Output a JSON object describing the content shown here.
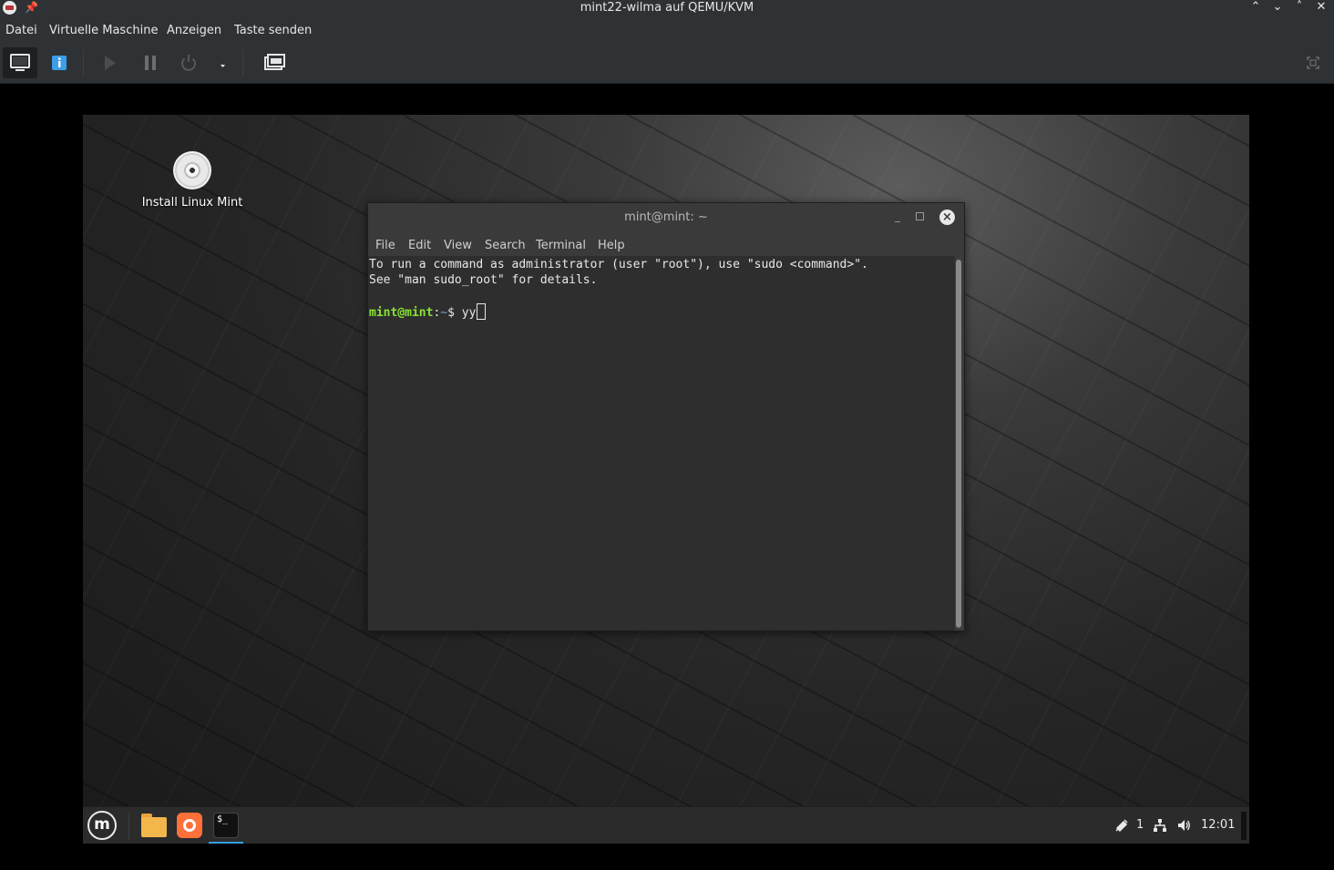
{
  "host": {
    "title": "mint22-wilma auf QEMU/KVM",
    "window_buttons": {
      "shade": "⌃",
      "minimize": "⌄",
      "maximize": "˄",
      "close": "✕"
    },
    "menu": [
      "Datei",
      "Virtuelle Maschine",
      "Anzeigen",
      "Taste senden"
    ],
    "toolbar": {
      "buttons": [
        "console-view",
        "details-view",
        "run",
        "pause",
        "shutdown",
        "shutdown-menu",
        "snapshots",
        "fullscreen"
      ],
      "active": "console-view"
    }
  },
  "guest": {
    "desktop_icon": {
      "label": "Install Linux Mint",
      "icon": "cd-disc-icon"
    },
    "terminal": {
      "title": "mint@mint: ~",
      "menu": [
        "File",
        "Edit",
        "View",
        "Search",
        "Terminal",
        "Help"
      ],
      "lines": [
        "To run a command as administrator (user \"root\"), use \"sudo <command>\".",
        "See \"man sudo_root\" for details."
      ],
      "prompt_user": "mint@mint",
      "prompt_sep": ":",
      "prompt_path": "~",
      "prompt_dollar": "$ ",
      "input": "yy",
      "colors": {
        "user": "#8ae234",
        "path": "#729fcf"
      }
    },
    "panel": {
      "launchers": [
        "mint-menu-icon",
        "files-icon",
        "firefox-icon",
        "terminal-icon"
      ],
      "notifications_count": "1",
      "clock": "12:01",
      "accent": "#35a0e0"
    }
  }
}
